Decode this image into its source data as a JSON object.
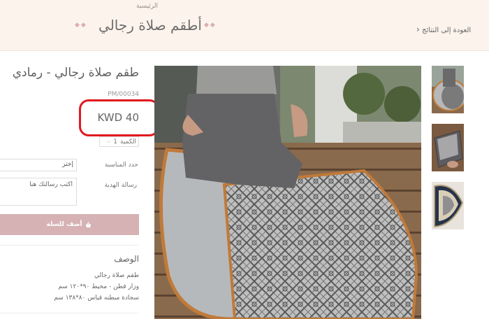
{
  "header": {
    "breadcrumb": "الرئيسية",
    "title": "أطقم صلاة رجالي",
    "diamonds": "◆◆",
    "back_link": "العودة إلى النتائج",
    "back_icon": "chevron-left-icon"
  },
  "product": {
    "title": "طقم صلاة رجالي - رمادي",
    "sku": "PM/00034",
    "price": "KWD 40",
    "quantity": {
      "value": "1",
      "label": "الكمية"
    },
    "occasion": {
      "label": "حدد المناسبة",
      "value": "إختر"
    },
    "gift_message": {
      "label": "رسالة الهدية",
      "placeholder": "اكتب رسالتك هنا"
    },
    "add_to_cart": "أضف للسلة",
    "description": {
      "title": "الوصف",
      "lines": [
        "طقم صلاة رجالي",
        "وزار قطن - مخيط ٩٠*١٢٠ سم",
        "سجادة مبطنه قياس ٨٠*١٣٨ سم"
      ]
    }
  },
  "colors": {
    "header_bg": "#fcf3ec",
    "accent_pink": "#d6b2b4",
    "annotation_red": "#e0191f"
  }
}
